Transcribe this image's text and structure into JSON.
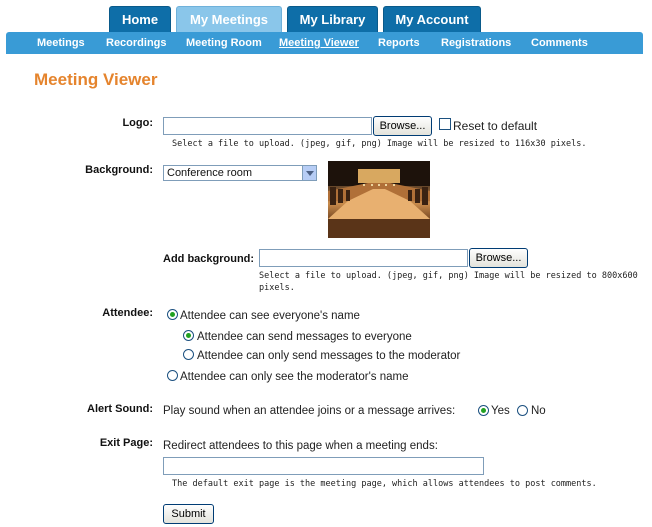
{
  "main_tabs": [
    {
      "label": "Home",
      "active": false
    },
    {
      "label": "My Meetings",
      "active": true
    },
    {
      "label": "My Library",
      "active": false
    },
    {
      "label": "My Account",
      "active": false
    }
  ],
  "sub_nav": [
    {
      "label": "Meetings",
      "active": false
    },
    {
      "label": "Recordings",
      "active": false
    },
    {
      "label": "Meeting Room",
      "active": false
    },
    {
      "label": "Meeting Viewer",
      "active": true
    },
    {
      "label": "Reports",
      "active": false
    },
    {
      "label": "Registrations",
      "active": false
    },
    {
      "label": "Comments",
      "active": false
    }
  ],
  "page_title": "Meeting Viewer",
  "logo": {
    "label": "Logo:",
    "browse_label": "Browse...",
    "reset_label": "Reset to default",
    "reset_checked": false,
    "hint": "Select a file to upload. (jpeg, gif, png) Image will be resized to 116x30 pixels."
  },
  "background": {
    "label": "Background:",
    "selected": "Conference room",
    "preview_icon": "conference-room-image",
    "add_label": "Add background:",
    "browse_label": "Browse...",
    "hint_line1": "Select a file to upload. (jpeg, gif, png) Image will be resized to 800x600",
    "hint_line2": "pixels."
  },
  "attendee": {
    "label": "Attendee:",
    "opt_see_everyone": "Attendee can see everyone's name",
    "opt_send_everyone": "Attendee can send messages to everyone",
    "opt_send_moderator": "Attendee can only send messages to the moderator",
    "opt_see_moderator": "Attendee can only see the moderator's name",
    "see_everyone_selected": true,
    "send_everyone_selected": true
  },
  "alert_sound": {
    "label": "Alert Sound:",
    "text": "Play sound when an attendee joins or a message arrives:",
    "yes": "Yes",
    "no": "No",
    "selected": "Yes"
  },
  "exit_page": {
    "label": "Exit Page:",
    "text": "Redirect attendees to this page when a meeting ends:",
    "value": "",
    "hint": "The default exit page is the meeting page, which allows attendees to post comments."
  },
  "submit_label": "Submit",
  "colors": {
    "tab_blue": "#0e6ea8",
    "subnav_blue": "#399bd6",
    "title_orange": "#e5842d",
    "radio_green": "#21a121"
  }
}
